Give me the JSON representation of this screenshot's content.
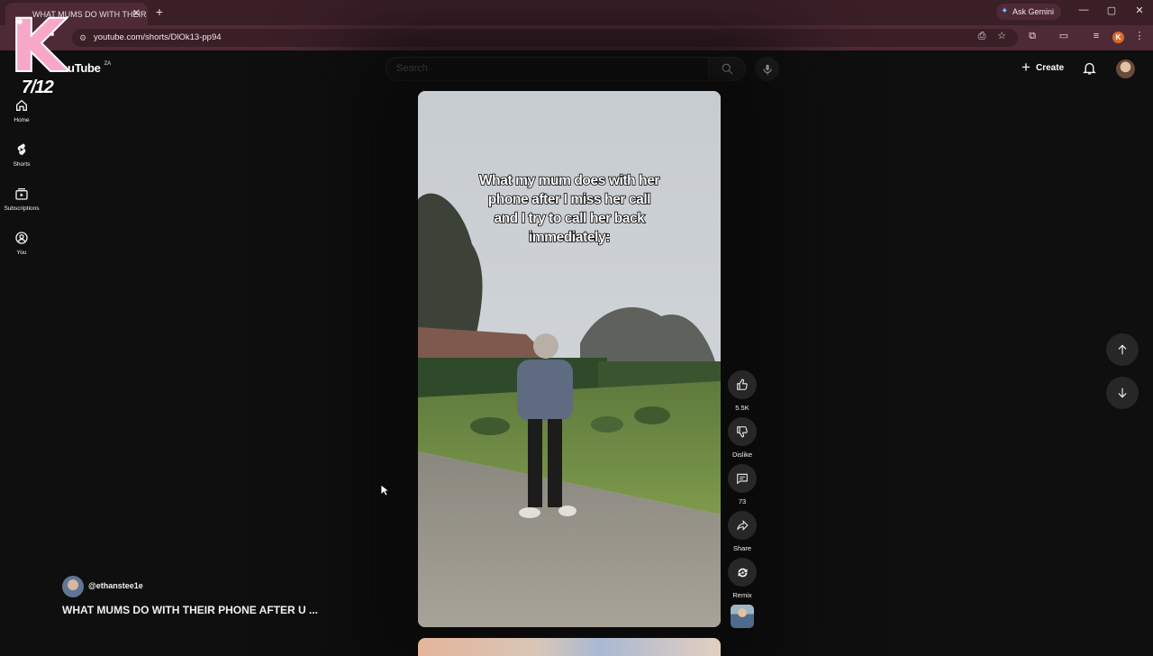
{
  "browser": {
    "tab_title": "WHAT MUMS DO WITH THEIR",
    "tab_close": "✕",
    "new_tab": "+",
    "ask_gemini": "Ask Gemini",
    "url": "youtube.com/shorts/DlOk13-pp94",
    "profile_initial": "K",
    "window_controls": [
      "—",
      "▢",
      "✕"
    ]
  },
  "overlay": {
    "sticker_letter": "K",
    "counter": "7/12"
  },
  "header": {
    "logo": "YouTube",
    "region": "ZA",
    "search_placeholder": "Search",
    "create_label": "Create"
  },
  "sidebar": {
    "items": [
      {
        "label": "Home",
        "icon": "home-icon"
      },
      {
        "label": "Shorts",
        "icon": "shorts-icon"
      },
      {
        "label": "Subscriptions",
        "icon": "subscriptions-icon"
      },
      {
        "label": "You",
        "icon": "you-icon"
      }
    ]
  },
  "video": {
    "caption": "What my mum does with her phone after I miss her call and I try to call her back immediately:",
    "channel": "@ethanstee1e",
    "title": "WHAT MUMS DO WITH THEIR PHONE AFTER U ..."
  },
  "actions": {
    "like_count": "5.5K",
    "dislike_label": "Dislike",
    "comment_count": "73",
    "share_label": "Share",
    "remix_label": "Remix"
  },
  "colors": {
    "tabbar": "#3a1f27",
    "toolbar": "#4d2a35",
    "page_bg": "#0f0f0f",
    "action_circle": "#272727"
  }
}
